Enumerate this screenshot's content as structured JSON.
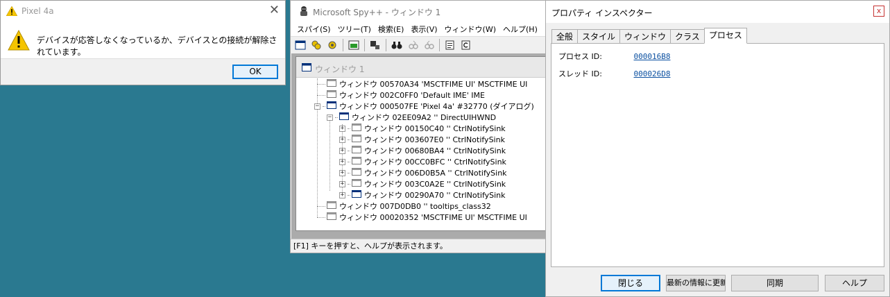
{
  "dialog": {
    "title": "Pixel 4a",
    "message": "デバイスが応答しなくなっているか、デバイスとの接続が解除されています。",
    "ok_label": "OK",
    "close_glyph": "✕"
  },
  "spy": {
    "title": "Microsoft Spy++ - ウィンドウ 1",
    "menu": [
      "スパイ(S)",
      "ツリー(T)",
      "検索(E)",
      "表示(V)",
      "ウィンドウ(W)",
      "ヘルプ(H)"
    ],
    "child_title": "ウィンドウ 1",
    "tree": [
      {
        "text": "ウィンドウ 00570A34 'MSCTFIME UI' MSCTFIME UI",
        "level": 0,
        "expander": "",
        "selected": false
      },
      {
        "text": "ウィンドウ 002C0FF0 'Default IME' IME",
        "level": 0,
        "expander": "",
        "selected": false
      },
      {
        "text": "ウィンドウ 000507FE 'Pixel 4a' #32770 (ダイアログ)",
        "level": 0,
        "expander": "-",
        "selected": true
      },
      {
        "text": "ウィンドウ 02EE09A2 '' DirectUIHWND",
        "level": 1,
        "expander": "-",
        "selected": true
      },
      {
        "text": "ウィンドウ 00150C40 '' CtrlNotifySink",
        "level": 2,
        "expander": "+",
        "selected": false
      },
      {
        "text": "ウィンドウ 003607E0 '' CtrlNotifySink",
        "level": 2,
        "expander": "+",
        "selected": false
      },
      {
        "text": "ウィンドウ 00680BA4 '' CtrlNotifySink",
        "level": 2,
        "expander": "+",
        "selected": false
      },
      {
        "text": "ウィンドウ 00CC0BFC '' CtrlNotifySink",
        "level": 2,
        "expander": "+",
        "selected": false
      },
      {
        "text": "ウィンドウ 006D0B5A '' CtrlNotifySink",
        "level": 2,
        "expander": "+",
        "selected": false
      },
      {
        "text": "ウィンドウ 003C0A2E '' CtrlNotifySink",
        "level": 2,
        "expander": "+",
        "selected": false
      },
      {
        "text": "ウィンドウ 00290A70 '' CtrlNotifySink",
        "level": 2,
        "expander": "+",
        "selected": true
      },
      {
        "text": "ウィンドウ 007D0DB0 '' tooltips_class32",
        "level": 0,
        "expander": "",
        "selected": false
      },
      {
        "text": "ウィンドウ 00020352 'MSCTFIME UI' MSCTFIME UI",
        "level": 0,
        "expander": "",
        "selected": false
      }
    ],
    "status": "[F1] キーを押すと、ヘルプが表示されます。"
  },
  "inspector": {
    "title": "プロパティ インスペクター",
    "close_glyph": "x",
    "tabs": [
      "全般",
      "スタイル",
      "ウィンドウ",
      "クラス",
      "プロセス"
    ],
    "active_tab": 4,
    "process_id_label": "プロセス ID:",
    "process_id_value": "000016B8",
    "thread_id_label": "スレッド ID:",
    "thread_id_value": "000026D8",
    "buttons": {
      "close": "閉じる",
      "refresh": "最新の情報に更新",
      "sync": "同期",
      "help": "ヘルプ"
    }
  },
  "colors": {
    "desktop": "#2a7990",
    "link": "#0a4fa0",
    "accent": "#0078d7"
  }
}
